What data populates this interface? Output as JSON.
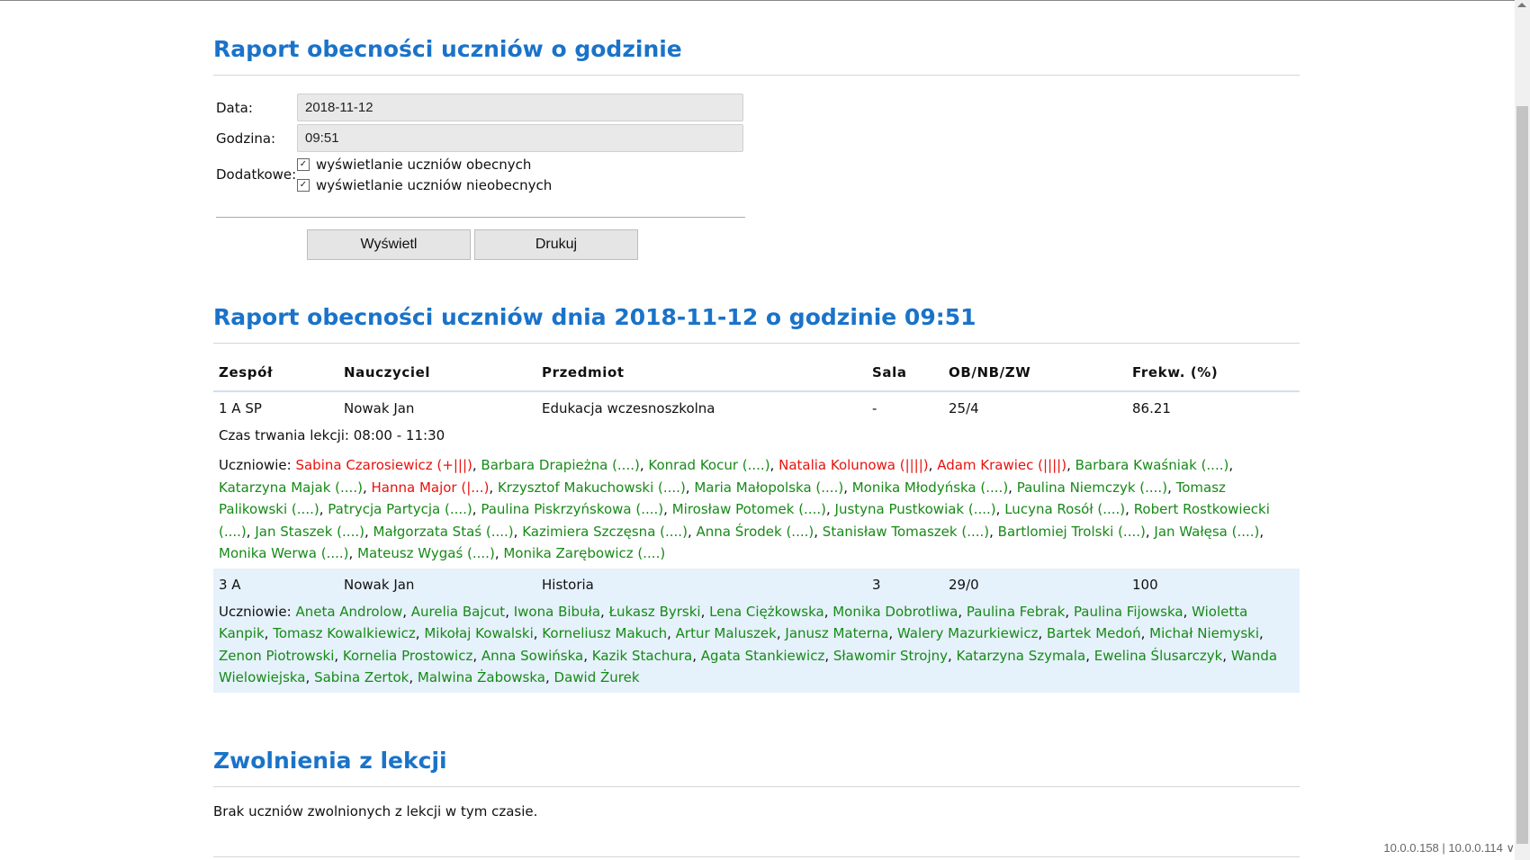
{
  "form": {
    "title": "Raport obecności uczniów o godzinie",
    "date_label": "Data:",
    "date_value": "2018-11-12",
    "hour_label": "Godzina:",
    "hour_value": "09:51",
    "extra_label": "Dodatkowe:",
    "cb_present_label": "wyświetlanie uczniów obecnych",
    "cb_absent_label": "wyświetlanie uczniów nieobecnych",
    "cb_present_checked": true,
    "cb_absent_checked": true,
    "btn_show": "Wyświetl",
    "btn_print": "Drukuj"
  },
  "report": {
    "title": "Raport obecności uczniów dnia 2018-11-12 o godzinie 09:51",
    "headers": [
      "Zespół",
      "Nauczyciel",
      "Przedmiot",
      "Sala",
      "OB/NB/ZW",
      "Frekw. (%)"
    ],
    "students_label": "Uczniowie:",
    "groups": [
      {
        "cells": [
          "1 A SP",
          "Nowak Jan",
          "Edukacja wczesnoszkolna",
          "-",
          "25/4",
          "86.21"
        ],
        "duration": "Czas trwania lekcji: 08:00 - 11:30",
        "students": [
          {
            "name": "Sabina Czarosiewicz (+|||)",
            "absent": true
          },
          {
            "name": "Barbara Drapieżna (....)",
            "absent": false
          },
          {
            "name": "Konrad Kocur (....)",
            "absent": false
          },
          {
            "name": "Natalia Kolunowa (||||)",
            "absent": true
          },
          {
            "name": "Adam Krawiec (||||)",
            "absent": true
          },
          {
            "name": "Barbara Kwaśniak (....)",
            "absent": false
          },
          {
            "name": "Katarzyna Majak (....)",
            "absent": false
          },
          {
            "name": "Hanna Major (|...)",
            "absent": true
          },
          {
            "name": "Krzysztof Makuchowski (....)",
            "absent": false
          },
          {
            "name": "Maria Małopolska (....)",
            "absent": false
          },
          {
            "name": "Monika Młodyńska (....)",
            "absent": false
          },
          {
            "name": "Paulina Niemczyk (....)",
            "absent": false
          },
          {
            "name": "Tomasz Palikowski (....)",
            "absent": false
          },
          {
            "name": "Patrycja Partycja (....)",
            "absent": false
          },
          {
            "name": "Paulina Piskrzyńskowa (....)",
            "absent": false
          },
          {
            "name": "Mirosław Potomek (....)",
            "absent": false
          },
          {
            "name": "Justyna Pustkowiak (....)",
            "absent": false
          },
          {
            "name": "Lucyna Rosół (....)",
            "absent": false
          },
          {
            "name": "Robert Rostkowiecki (....)",
            "absent": false
          },
          {
            "name": "Jan Staszek (....)",
            "absent": false
          },
          {
            "name": "Małgorzata Staś (....)",
            "absent": false
          },
          {
            "name": "Kazimiera Szczęsna (....)",
            "absent": false
          },
          {
            "name": "Anna Środek (....)",
            "absent": false
          },
          {
            "name": "Stanisław Tomaszek (....)",
            "absent": false
          },
          {
            "name": "Bartlomiej Trolski (....)",
            "absent": false
          },
          {
            "name": "Jan Wałęsa (....)",
            "absent": false
          },
          {
            "name": "Monika Werwa (....)",
            "absent": false
          },
          {
            "name": "Mateusz Wygaś (....)",
            "absent": false
          },
          {
            "name": "Monika Zarębowicz (....)",
            "absent": false
          }
        ]
      },
      {
        "cells": [
          "3 A",
          "Nowak Jan",
          "Historia",
          "3",
          "29/0",
          "100"
        ],
        "duration": "",
        "students": [
          {
            "name": "Aneta Androlow",
            "absent": false
          },
          {
            "name": "Aurelia Bajcut",
            "absent": false
          },
          {
            "name": "Iwona Bibuła",
            "absent": false
          },
          {
            "name": "Łukasz Byrski",
            "absent": false
          },
          {
            "name": "Lena Ciężkowska",
            "absent": false
          },
          {
            "name": "Monika Dobrotliwa",
            "absent": false
          },
          {
            "name": "Paulina Febrak",
            "absent": false
          },
          {
            "name": "Paulina Fijowska",
            "absent": false
          },
          {
            "name": "Wioletta Kanpik",
            "absent": false
          },
          {
            "name": "Tomasz Kowalkiewicz",
            "absent": false
          },
          {
            "name": "Mikołaj Kowalski",
            "absent": false
          },
          {
            "name": "Korneliusz Makuch",
            "absent": false
          },
          {
            "name": "Artur Maluszek",
            "absent": false
          },
          {
            "name": "Janusz Materna",
            "absent": false
          },
          {
            "name": "Walery Mazurkiewicz",
            "absent": false
          },
          {
            "name": "Bartek Medoń",
            "absent": false
          },
          {
            "name": "Michał Niemyski",
            "absent": false
          },
          {
            "name": "Zenon Piotrowski",
            "absent": false
          },
          {
            "name": "Kornelia Prostowicz",
            "absent": false
          },
          {
            "name": "Anna Sowińska",
            "absent": false
          },
          {
            "name": "Kazik Stachura",
            "absent": false
          },
          {
            "name": "Agata Stankiewicz",
            "absent": false
          },
          {
            "name": "Sławomir Strojny",
            "absent": false
          },
          {
            "name": "Katarzyna Szymala",
            "absent": false
          },
          {
            "name": "Ewelina Ślusarczyk",
            "absent": false
          },
          {
            "name": "Wanda Wielowiejska",
            "absent": false
          },
          {
            "name": "Sabina Zertok",
            "absent": false
          },
          {
            "name": "Malwina Żabowska",
            "absent": false
          },
          {
            "name": "Dawid Żurek",
            "absent": false
          }
        ]
      }
    ]
  },
  "dismissals": {
    "title": "Zwolnienia z lekcji",
    "text": "Brak uczniów zwolnionych z lekcji w tym czasie."
  },
  "footer": {
    "text": "10.0.0.158 | 10.0.0.114 ∨"
  },
  "colors": {
    "heading": "#1a73c9",
    "present": "#178a17",
    "absent": "#e8120c",
    "row_alt": "#e5f1fb"
  }
}
